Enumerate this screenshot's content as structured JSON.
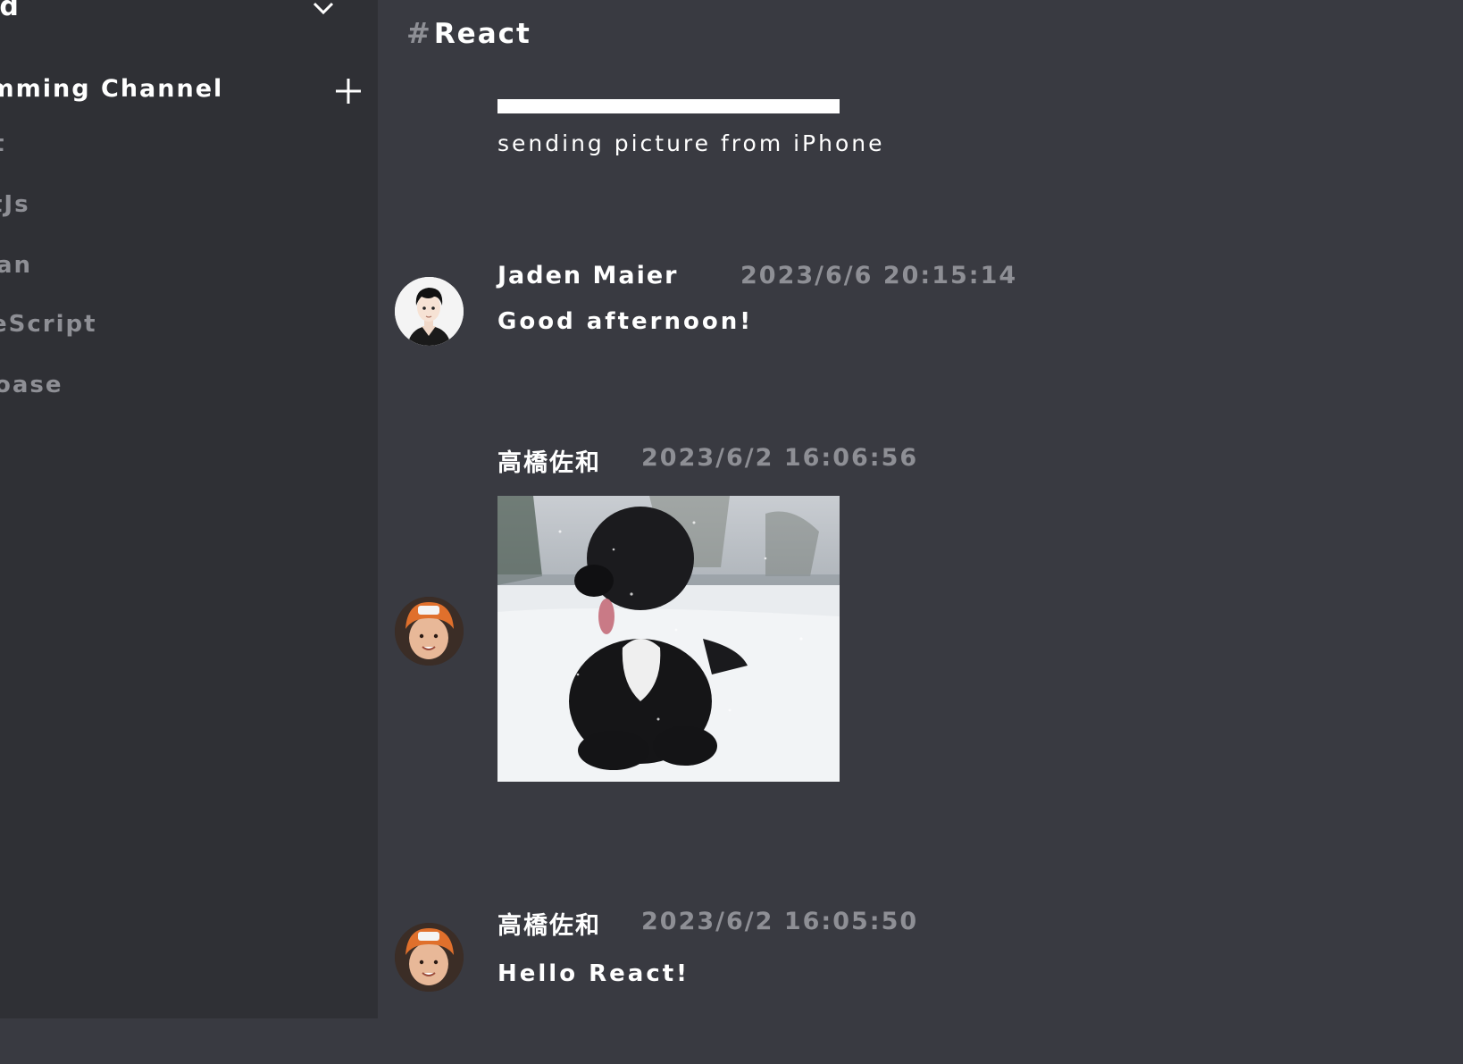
{
  "sidebar": {
    "server_title": "ord",
    "category": "ramming Channel",
    "channels": [
      {
        "label": "t"
      },
      {
        "label": "tJs"
      },
      {
        "label": "an"
      },
      {
        "label": "eScript"
      },
      {
        "label": "oase"
      }
    ]
  },
  "channel": {
    "hash": "#",
    "name": "React"
  },
  "messages": [
    {
      "text": "sending picture from iPhone"
    },
    {
      "author": "Jaden Maier",
      "timestamp": "2023/6/6 20:15:14",
      "text": "Good afternoon!"
    },
    {
      "author": "高橋佐和",
      "timestamp": "2023/6/2 16:06:56"
    },
    {
      "author": "高橋佐和",
      "timestamp": "2023/6/2 16:05:50",
      "text": "Hello React!"
    }
  ],
  "colors": {
    "sidebar_bg": "#2f3035",
    "main_bg": "#393a41",
    "text_primary": "#ffffff",
    "text_muted": "#8e8f95",
    "avatar_hat": "#e0702c"
  }
}
